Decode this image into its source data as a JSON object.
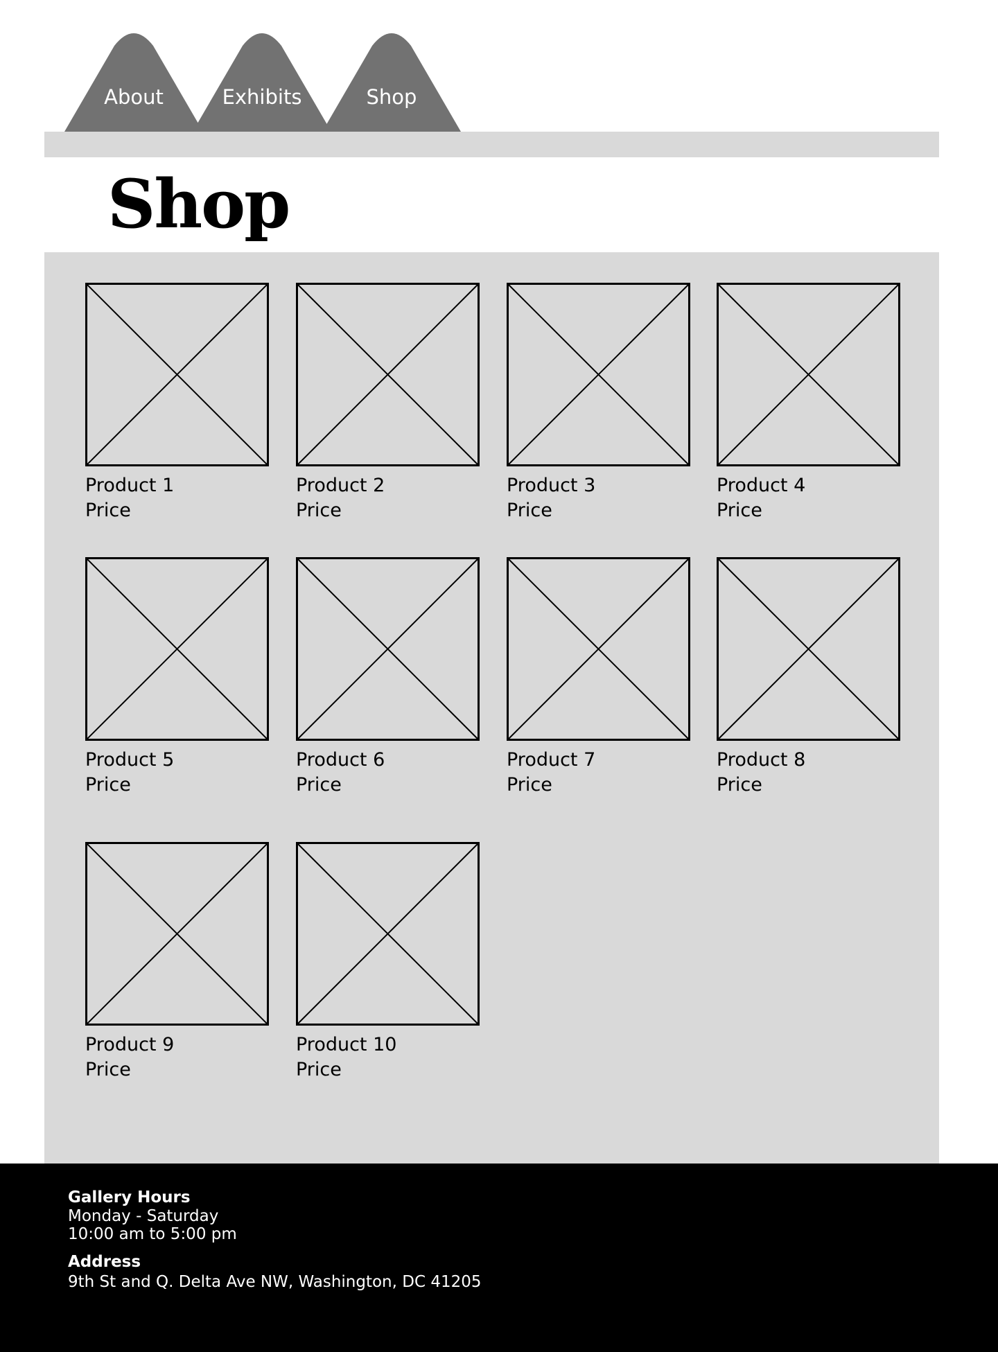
{
  "nav": {
    "tabs": [
      {
        "label": "About"
      },
      {
        "label": "Exhibits"
      },
      {
        "label": "Shop"
      }
    ]
  },
  "page": {
    "title": "Shop"
  },
  "products": [
    {
      "name": "Product 1",
      "price": "Price"
    },
    {
      "name": "Product 2",
      "price": "Price"
    },
    {
      "name": "Product 3",
      "price": "Price"
    },
    {
      "name": "Product 4",
      "price": "Price"
    },
    {
      "name": "Product 5",
      "price": "Price"
    },
    {
      "name": "Product 6",
      "price": "Price"
    },
    {
      "name": "Product 7",
      "price": "Price"
    },
    {
      "name": "Product 8",
      "price": "Price"
    },
    {
      "name": "Product 9",
      "price": "Price"
    },
    {
      "name": "Product 10",
      "price": "Price"
    }
  ],
  "footer": {
    "hours_heading": "Gallery Hours",
    "hours_days": "Monday - Saturday",
    "hours_time": "10:00 am to 5:00 pm",
    "address_heading": "Address",
    "address_line": "9th St and Q. Delta Ave NW, Washington, DC 41205"
  },
  "icons": {
    "product_image": "image-placeholder-icon"
  },
  "colors": {
    "tab": "#727272",
    "panel": "#d9d9d9",
    "footer": "#000000"
  }
}
